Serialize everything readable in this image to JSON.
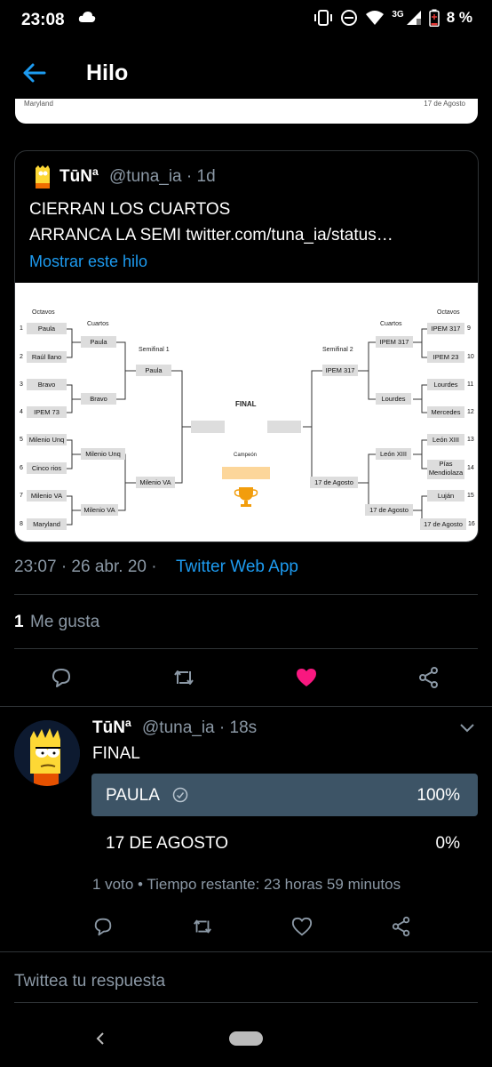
{
  "status_bar": {
    "time": "23:08",
    "network": "3G",
    "battery": "8 %"
  },
  "header": {
    "title": "Hilo"
  },
  "cropped_card": {
    "left_text": "Maryland",
    "right_text": "17 de Agosto"
  },
  "quoted_tweet": {
    "name": "TūNª",
    "handle": "@tuna_ia · 1d",
    "line1": "CIERRAN LOS CUARTOS",
    "line2": "ARRANCA LA SEMI twitter.com/tuna_ia/status…",
    "show_thread": "Mostrar este hilo",
    "bracket": {
      "octavos_left": "Octavos",
      "cuartos_left": "Cuartos",
      "semifinal1": "Semifinal 1",
      "final": "FINAL",
      "campeon": "Campeón",
      "semifinal2": "Semifinal 2",
      "cuartos_right": "Cuartos",
      "octavos_right": "Octavos",
      "left_octavos": [
        {
          "n": "1",
          "name": "Paula"
        },
        {
          "n": "2",
          "name": "Raúl llano"
        },
        {
          "n": "3",
          "name": "Bravo"
        },
        {
          "n": "4",
          "name": "IPEM 73"
        },
        {
          "n": "5",
          "name": "Milenio Unq"
        },
        {
          "n": "6",
          "name": "Cinco rios"
        },
        {
          "n": "7",
          "name": "Milenio VA"
        },
        {
          "n": "8",
          "name": "Maryland"
        }
      ],
      "left_cuartos": [
        "Paula",
        "Bravo",
        "Milenio Unq",
        "Milenio VA"
      ],
      "left_semi": [
        "Paula",
        "Milenio VA"
      ],
      "right_octavos": [
        {
          "n": "9",
          "name": "IPEM 317"
        },
        {
          "n": "10",
          "name": "IPEM 23"
        },
        {
          "n": "11",
          "name": "Lourdes"
        },
        {
          "n": "12",
          "name": "Mercedes"
        },
        {
          "n": "13",
          "name": "León XIII"
        },
        {
          "n": "14",
          "name": "Pías Mendiolaza"
        },
        {
          "n": "15",
          "name": "Luján"
        },
        {
          "n": "16",
          "name": "17 de Agosto"
        }
      ],
      "right_cuartos": [
        "IPEM 317",
        "Lourdes",
        "León XIII",
        "17 de Agosto"
      ],
      "right_semi": [
        "IPEM 317",
        "17 de Agosto"
      ]
    }
  },
  "meta": {
    "date": "23:07 · 26 abr. 20 ·",
    "app": "Twitter Web App",
    "likes_count": "1",
    "likes_label": "Me gusta"
  },
  "actions": {
    "reply_icon": "comment-icon",
    "retweet_icon": "retweet-icon",
    "like_icon": "heart-filled-icon",
    "share_icon": "share-icon",
    "like_color": "#f91880"
  },
  "reply": {
    "name": "TūNª",
    "handle": "@tuna_ia · 18s",
    "text": "FINAL",
    "poll": {
      "options": [
        {
          "label": "PAULA",
          "percent": "100%",
          "winner": true
        },
        {
          "label": "17 DE AGOSTO",
          "percent": "0%",
          "winner": false
        }
      ],
      "footer": "1 voto • Tiempo restante: 23 horas 59 minutos"
    }
  },
  "compose": {
    "placeholder": "Twittea tu respuesta"
  },
  "colors": {
    "background": "#000000",
    "accent": "#1d9bf0",
    "muted": "#8b98a5",
    "poll_winner": "#3d5466"
  }
}
